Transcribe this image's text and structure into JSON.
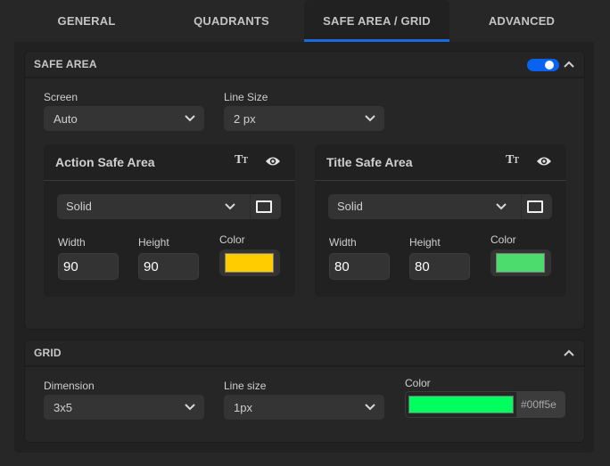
{
  "tabs": [
    {
      "label": "GENERAL",
      "active": false
    },
    {
      "label": "QUADRANTS",
      "active": false
    },
    {
      "label": "SAFE AREA / GRID",
      "active": true
    },
    {
      "label": "ADVANCED",
      "active": false
    }
  ],
  "safe_area": {
    "title": "SAFE AREA",
    "enabled": true,
    "screen": {
      "label": "Screen",
      "value": "Auto"
    },
    "line_size": {
      "label": "Line Size",
      "value": "2 px"
    },
    "cards": [
      {
        "title": "Action Safe Area",
        "line_style": "Solid",
        "width_label": "Width",
        "width": "90",
        "height_label": "Height",
        "height": "90",
        "color_label": "Color",
        "color": "#ffcc00"
      },
      {
        "title": "Title Safe Area",
        "line_style": "Solid",
        "width_label": "Width",
        "width": "80",
        "height_label": "Height",
        "height": "80",
        "color_label": "Color",
        "color": "#4cdc6e"
      }
    ]
  },
  "grid": {
    "title": "GRID",
    "dimension": {
      "label": "Dimension",
      "value": "3x5"
    },
    "line_size": {
      "label": "Line size",
      "value": "1px"
    },
    "color": {
      "label": "Color",
      "value": "#00ff5e"
    }
  },
  "icons": {
    "text_size": "Tт",
    "accent": "#1a6be0"
  }
}
